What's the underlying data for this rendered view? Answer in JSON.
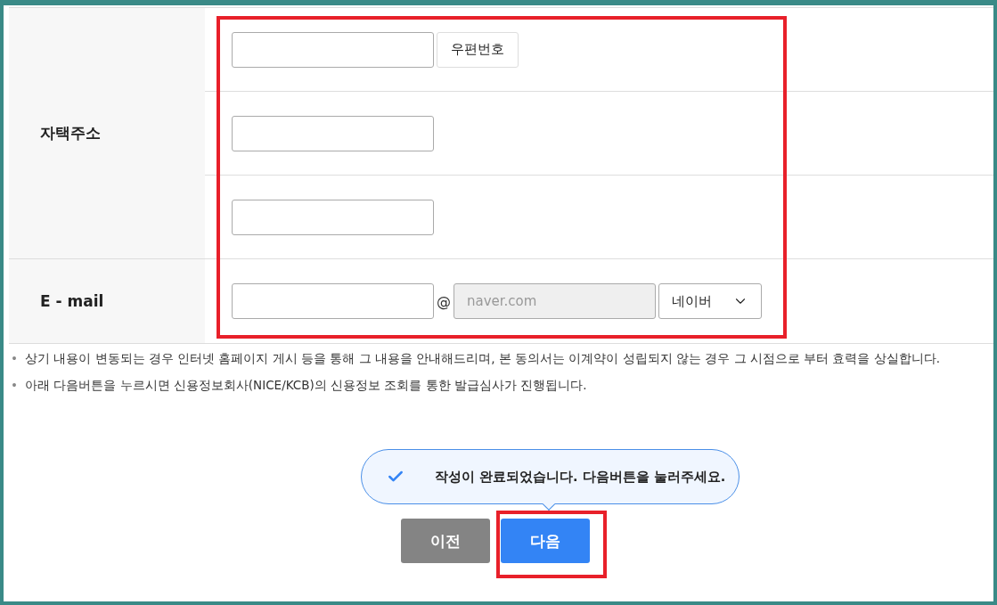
{
  "address": {
    "label": "자택주소",
    "fields": [
      {
        "kind": "postcode",
        "button": "우편번호"
      },
      {
        "kind": "line"
      },
      {
        "kind": "line"
      }
    ]
  },
  "email": {
    "label": "E - mail",
    "at": "@",
    "domain": {
      "value": "naver.com",
      "disabled": true
    },
    "provider": "네이버"
  },
  "notes": [
    {
      "bullet": "•",
      "text": "상기 내용이 변동되는 경우 인터넷 홈페이지 게시 등을 통해 그 내용을 안내해드리며, 본 동의서는 이계약이 성립되지 않는 경우 그 시점으로 부터 효력을 상실합니다."
    },
    {
      "bullet": "•",
      "text": "아래 다음버튼을 누르시면 신용정보회사(NICE/KCB)의 신용정보 조회를 통한 발급심사가 진행됩니다."
    }
  ],
  "tooltip": {
    "text": "작성이 완료되었습니다. 다음버튼을 눌러주세요."
  },
  "buttons": [
    {
      "label": "이전",
      "kind": "secondary"
    },
    {
      "label": "다음",
      "kind": "primary"
    }
  ]
}
